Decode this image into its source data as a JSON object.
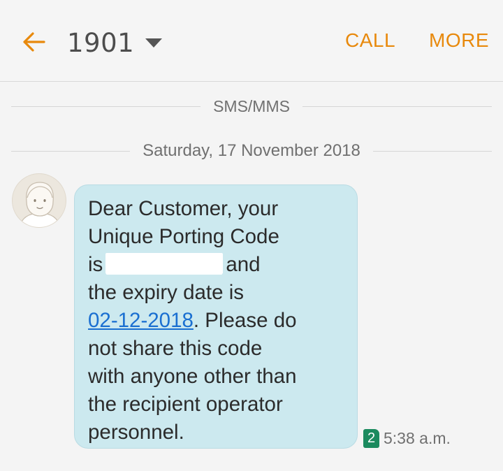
{
  "header": {
    "title": "1901",
    "call_label": "CALL",
    "more_label": "MORE",
    "accent_color": "#e8890c"
  },
  "thread": {
    "channel_label": "SMS/MMS",
    "date_label": "Saturday, 17 November 2018"
  },
  "message": {
    "line1": "Dear Customer, your",
    "line2": "Unique Porting Code",
    "line3_prefix": "is",
    "line3_suffix": "and",
    "line4": "the expiry date is",
    "expiry_link": "02-12-2018",
    "line5_suffix": ". Please do",
    "line6": "not share this code",
    "line7": "with anyone other than",
    "line8": "the recipient operator",
    "line9": "personnel.",
    "sim_slot": "2",
    "time": "5:38 a.m.",
    "bubble_color": "#cce9ef"
  },
  "icons": {
    "back": "arrow-left-icon",
    "dropdown": "caret-down-icon",
    "avatar": "contact-avatar-icon"
  }
}
